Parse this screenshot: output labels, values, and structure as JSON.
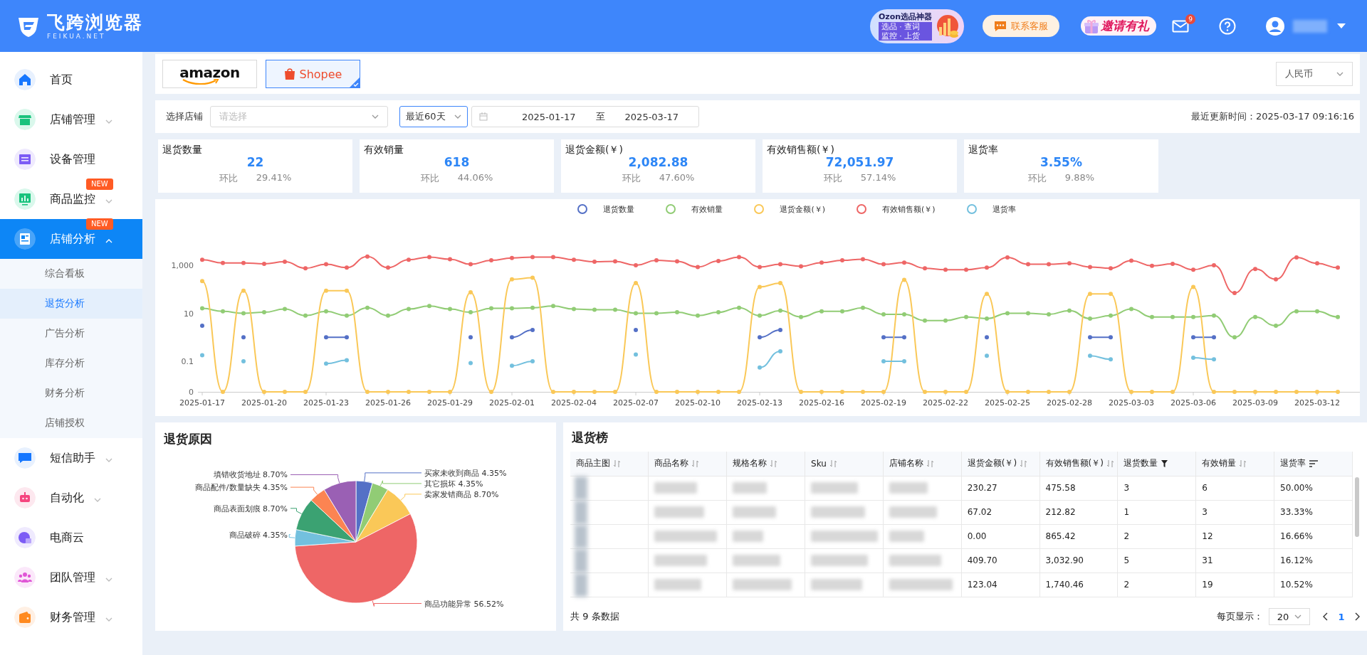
{
  "header": {
    "logo_title": "飞跨浏览器",
    "logo_subtitle": "FEIKUA.NET",
    "promo": {
      "title": "Ozon选品神器",
      "line_1": "选品 · 查词",
      "line_2": "监控 · 上货"
    },
    "support_button": "联系客服",
    "invite_link": "邀请有礼",
    "mail_badge": "9"
  },
  "sidebar": {
    "items": [
      {
        "label": "首页",
        "kind": "link",
        "selected": false
      },
      {
        "label": "店铺管理",
        "kind": "group",
        "selected": false,
        "expanded": false
      },
      {
        "label": "设备管理",
        "kind": "link",
        "selected": false
      },
      {
        "label": "商品监控",
        "kind": "group",
        "badge": "NEW",
        "selected": false,
        "expanded": false
      },
      {
        "label": "店铺分析",
        "kind": "group",
        "badge": "NEW",
        "selected": true,
        "expanded": true,
        "children": [
          {
            "label": "综合看板",
            "selected": false
          },
          {
            "label": "退货分析",
            "selected": true
          },
          {
            "label": "广告分析",
            "selected": false
          },
          {
            "label": "库存分析",
            "selected": false
          },
          {
            "label": "财务分析",
            "selected": false
          },
          {
            "label": "店铺授权",
            "selected": false
          }
        ]
      },
      {
        "label": "短信助手",
        "kind": "group",
        "selected": false,
        "expanded": false
      },
      {
        "label": "自动化",
        "kind": "group",
        "selected": false,
        "expanded": false
      },
      {
        "label": "电商云",
        "kind": "link",
        "selected": false
      },
      {
        "label": "团队管理",
        "kind": "group",
        "selected": false,
        "expanded": false
      },
      {
        "label": "财务管理",
        "kind": "group",
        "selected": false,
        "expanded": false
      }
    ]
  },
  "platform_tabs": [
    {
      "label": "amazon",
      "kind": "amazon",
      "selected": false
    },
    {
      "label": "Shopee",
      "kind": "shopee",
      "selected": true
    }
  ],
  "currency_select": {
    "value": "人民币"
  },
  "filters": {
    "store_label": "选择店铺",
    "store_select": {
      "placeholder": "请选择"
    },
    "range_select": {
      "value": "最近60天"
    },
    "start_date": "2025-01-17",
    "range_separator": "至",
    "end_date": "2025-03-17",
    "updated": "最近更新时间：2025-03-17 09:16:16"
  },
  "kpis": [
    {
      "label": "退货数量",
      "value": "22",
      "compare_label": "环比",
      "compare_value": "29.41%"
    },
    {
      "label": "有效销量",
      "value": "618",
      "compare_label": "环比",
      "compare_value": "44.06%"
    },
    {
      "label": "退货金额(￥)",
      "value": "2,082.88",
      "compare_label": "环比",
      "compare_value": "47.60%"
    },
    {
      "label": "有效销售额(￥)",
      "value": "72,051.97",
      "compare_label": "环比",
      "compare_value": "57.14%"
    },
    {
      "label": "退货率",
      "value": "3.55%",
      "compare_label": "环比",
      "compare_value": "9.88%"
    }
  ],
  "trend_chart": {
    "legend": [
      {
        "label": "退货数量",
        "color": "#5470c6"
      },
      {
        "label": "有效销量",
        "color": "#91cc75"
      },
      {
        "label": "退货金额(￥)",
        "color": "#fac858"
      },
      {
        "label": "有效销售额(￥)",
        "color": "#ee6666"
      },
      {
        "label": "退货率",
        "color": "#73c0de"
      }
    ],
    "y_axis_labels": [
      "1,000",
      "10",
      "0.1",
      "0"
    ],
    "x_axis_labels": [
      "2025-01-17",
      "2025-01-20",
      "2025-01-23",
      "2025-01-26",
      "2025-01-29",
      "2025-02-01",
      "2025-02-04",
      "2025-02-07",
      "2025-02-10",
      "2025-02-13",
      "2025-02-16",
      "2025-02-19",
      "2025-02-22",
      "2025-02-25",
      "2025-02-28",
      "2025-03-03",
      "2025-03-06",
      "2025-03-09",
      "2025-03-12"
    ]
  },
  "return_reasons": {
    "title": "退货原因",
    "chart_data": {
      "type": "pie",
      "categories": [
        "买家未收到商品",
        "其它损坏",
        "卖家发错商品",
        "商品功能异常",
        "商品破碎",
        "商品表面划痕",
        "商品配件/数量缺失",
        "填错收货地址"
      ],
      "values": [
        4.35,
        4.35,
        8.7,
        56.52,
        4.35,
        8.7,
        4.35,
        8.7
      ],
      "value_labels": [
        "4.35%",
        "4.35%",
        "8.70%",
        "56.52%",
        "4.35%",
        "8.70%",
        "4.35%",
        "8.70%"
      ]
    }
  },
  "return_ranking": {
    "title": "退货榜",
    "columns": [
      {
        "label": "商品主图",
        "kind": "sort"
      },
      {
        "label": "商品名称",
        "kind": "sort"
      },
      {
        "label": "规格名称",
        "kind": "sort"
      },
      {
        "label": "Sku",
        "kind": "sort"
      },
      {
        "label": "店铺名称",
        "kind": "sort"
      },
      {
        "label": "退货金额(￥)",
        "kind": "sort"
      },
      {
        "label": "有效销售额(￥)",
        "kind": "sort"
      },
      {
        "label": "退货数量",
        "kind": "filter"
      },
      {
        "label": "有效销量",
        "kind": "sort"
      },
      {
        "label": "退货率",
        "kind": "order"
      }
    ],
    "rows": [
      {
        "cells": [
          "230.27",
          "475.58",
          "3",
          "6",
          "50.00%"
        ]
      },
      {
        "cells": [
          "67.02",
          "212.82",
          "1",
          "3",
          "33.33%"
        ]
      },
      {
        "cells": [
          "0.00",
          "865.42",
          "2",
          "12",
          "16.66%"
        ]
      },
      {
        "cells": [
          "409.70",
          "3,032.90",
          "5",
          "31",
          "16.12%"
        ]
      },
      {
        "cells": [
          "123.04",
          "1,740.46",
          "2",
          "19",
          "10.52%"
        ]
      }
    ],
    "total": "共 9 条数据",
    "page_size_label": "每页显示：",
    "page_size": "20",
    "pages": [
      {
        "label": "1",
        "selected": true
      }
    ]
  }
}
